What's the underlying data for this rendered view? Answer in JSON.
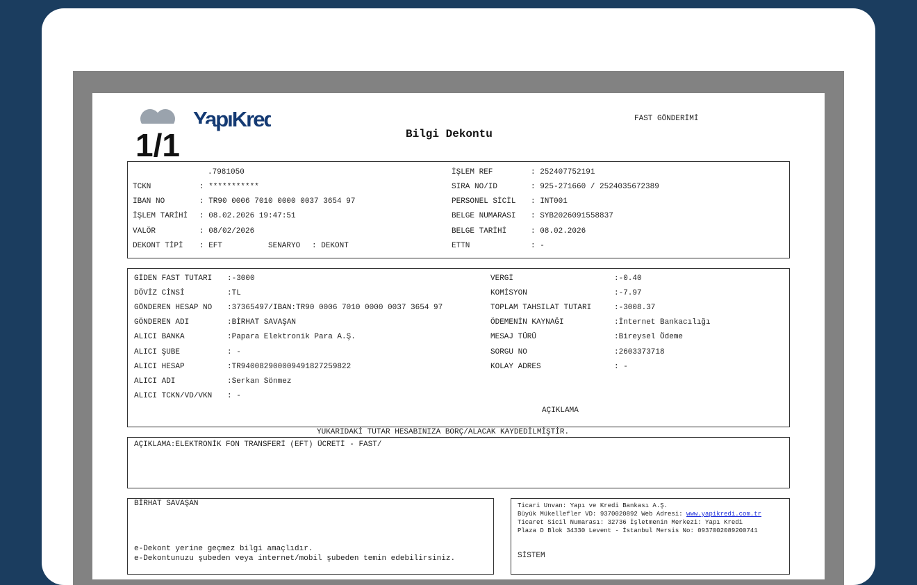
{
  "viewer": {
    "page_counter": "1/1"
  },
  "header": {
    "brand": "YapıKredi",
    "title": "Bilgi Dekontu",
    "doc_type": "FAST GÖNDERİMİ"
  },
  "info": {
    "customer_no_partial": ".7981050",
    "tckn_label": "TCKN",
    "tckn": ": ***********",
    "iban_label": "IBAN NO",
    "iban": ": TR90 0006 7010 0000 0037 3654 97",
    "islem_tarihi_label": "İŞLEM TARİHİ",
    "islem_tarihi": ": 08.02.2026 19:47:51",
    "valor_label": "VALÖR",
    "valor": ": 08/02/2026",
    "dekont_tipi_label": "DEKONT TİPİ",
    "dekont_tipi": ": EFT",
    "senaryo_label": "SENARYO",
    "senaryo": ": DEKONT",
    "islem_ref_label": "İŞLEM REF",
    "islem_ref": ": 252407752191",
    "sira_no_label": "SIRA NO/ID",
    "sira_no": ": 925-271660 / 2524035672389",
    "personel_label": "PERSONEL SİCİL",
    "personel": ": INT001",
    "belge_no_label": "BELGE NUMARASI",
    "belge_no": ": SYB2026091558837",
    "belge_tarihi_label": "BELGE TARİHİ",
    "belge_tarihi": ": 08.02.2026",
    "ettn_label": "ETTN",
    "ettn": ": -"
  },
  "transfer": {
    "left": [
      {
        "label": "GİDEN FAST TUTARI",
        "value": ":-3000"
      },
      {
        "label": "DÖVİZ CİNSİ",
        "value": ":TL"
      },
      {
        "label": "GÖNDEREN HESAP NO",
        "value": ":37365497/IBAN:TR90 0006 7010 0000 0037 3654 97"
      },
      {
        "label": "GÖNDEREN ADI",
        "value": ":BİRHAT SAVAŞAN"
      },
      {
        "label": "ALICI BANKA",
        "value": ":Papara Elektronik Para A.Ş."
      },
      {
        "label": "ALICI ŞUBE",
        "value": ": -"
      },
      {
        "label": "ALICI HESAP",
        "value": ":TR940082900009491827259822"
      },
      {
        "label": "ALICI ADI",
        "value": ":Serkan Sönmez"
      },
      {
        "label": "ALICI TCKN/VD/VKN",
        "value": ": -"
      }
    ],
    "right": [
      {
        "label": "VERGİ",
        "value": ":-0.40"
      },
      {
        "label": "KOMİSYON",
        "value": ":-7.97"
      },
      {
        "label": "TOPLAM TAHSILAT TUTARI",
        "value": ":-3008.37"
      },
      {
        "label": "ÖDEMENİN KAYNAĞI",
        "value": ":İnternet Bankacılığı"
      },
      {
        "label": "MESAJ TÜRÜ",
        "value": ":Bireysel Ödeme"
      },
      {
        "label": "SORGU NO",
        "value": ":2603373718"
      },
      {
        "label": "KOLAY ADRES",
        "value": ": -"
      }
    ],
    "aciklama_heading": "AÇIKLAMA"
  },
  "notice": "YUKARIDAKİ TUTAR HESABINIZA BORÇ/ALACAK KAYDEDİLMİŞTİR.",
  "description": "AÇIKLAMA:ELEKTRONİK FON TRANSFERİ (EFT) ÜCRETİ - FAST/",
  "footer_left": {
    "name": "BİRHAT SAVAŞAN",
    "note1": "e-Dekont yerine geçmez bilgi amaçlıdır.",
    "note2": "e-Dekontunuzu şubeden veya internet/mobil şubeden temin edebilirsiniz."
  },
  "footer_right": {
    "line1": "Ticari Unvan: Yapı ve Kredi Bankası A.Ş.",
    "line2_prefix": "Büyük Mükellefler VD: 9370020892 Web Adresi:",
    "website": "www.yapikredi.com.tr",
    "line3": "Ticaret Sicil Numarası: 32736 İşletmenin Merkezi: Yapı Kredi",
    "line4": "Plaza D Blok 34330 Levent - İstanbul Mersis No: 0937002089200741",
    "system": "SİSTEM"
  },
  "colors": {
    "background": "#1b3d5f",
    "viewer": "#828282",
    "brand": "#143a73",
    "link": "#1a2bd9"
  }
}
